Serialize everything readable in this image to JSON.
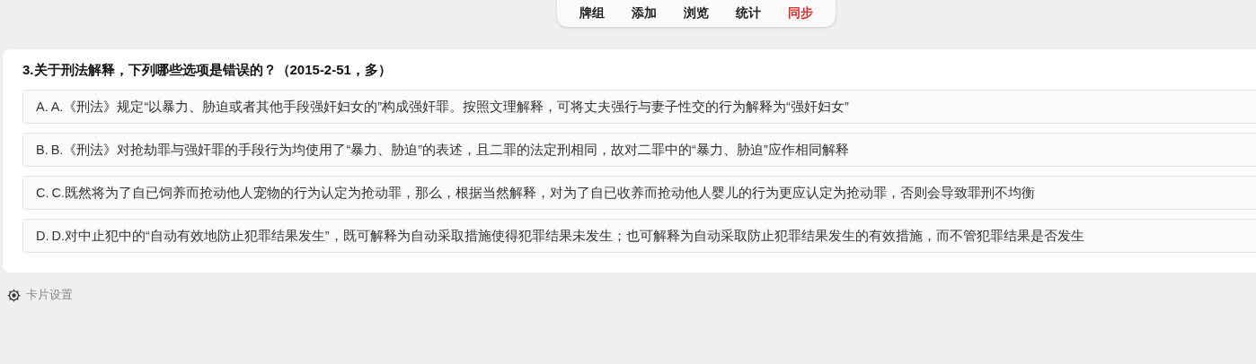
{
  "nav": [
    {
      "label": "牌组",
      "alert": false
    },
    {
      "label": "添加",
      "alert": false
    },
    {
      "label": "浏览",
      "alert": false
    },
    {
      "label": "统计",
      "alert": false
    },
    {
      "label": "同步",
      "alert": true
    }
  ],
  "question": {
    "title": "3.关于刑法解释，下列哪些选项是错误的？（2015-2-51，多）",
    "options": [
      {
        "letter": "A.",
        "text": "A.《刑法》规定“以暴力、胁迫或者其他手段强奸妇女的”构成强奸罪。按照文理解释，可将丈夫强行与妻子性交的行为解释为“强奸妇女”"
      },
      {
        "letter": "B.",
        "text": "B.《刑法》对抢劫罪与强奸罪的手段行为均使用了“暴力、胁迫”的表述，且二罪的法定刑相同，故对二罪中的“暴力、胁迫”应作相同解释"
      },
      {
        "letter": "C.",
        "text": "C.既然将为了自已饲养而抢动他人宠物的行为认定为抢动罪，那么，根据当然解释，对为了自已收养而抢动他人婴儿的行为更应认定为抢动罪，否则会导致罪刑不均衡"
      },
      {
        "letter": "D.",
        "text": "D.对中止犯中的“自动有效地防止犯罪结果发生”，既可解释为自动采取措施使得犯罪结果未发生；也可解释为自动采取防止犯罪结果发生的有效措施，而不管犯罪结果是否发生"
      }
    ]
  },
  "footer": {
    "settings": "卡片设置"
  }
}
